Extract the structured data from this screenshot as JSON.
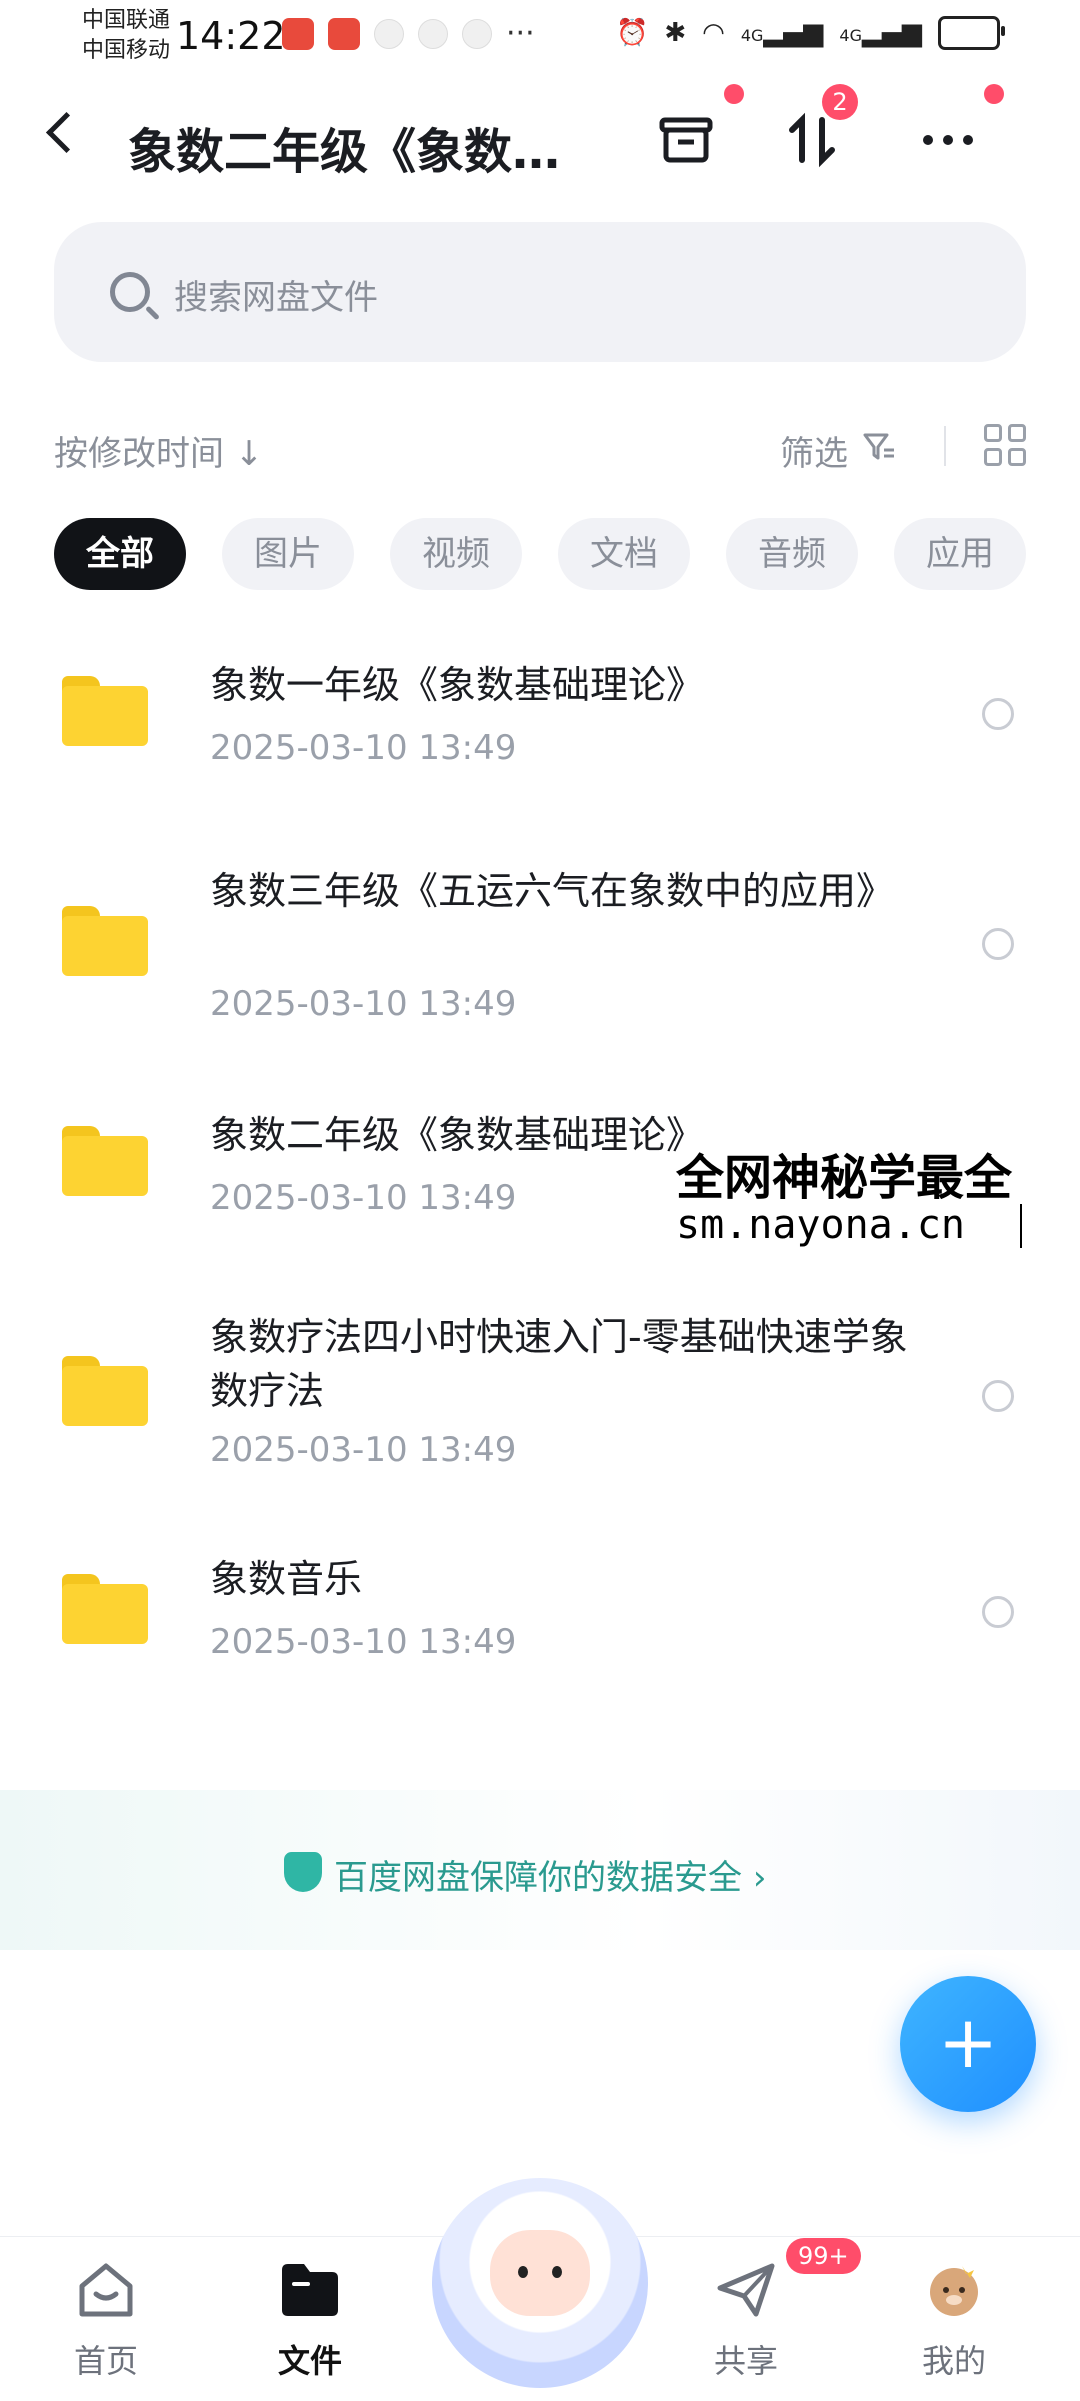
{
  "status_bar": {
    "carrier1": "中国联通",
    "carrier2": "中国移动",
    "time": "14:22",
    "dots": "···",
    "net1": "4G",
    "net2": "4G"
  },
  "header": {
    "title": "象数二年级《象数基础理论》",
    "transfer_badge": "2"
  },
  "search": {
    "placeholder": "搜索网盘文件"
  },
  "toolbar": {
    "sort_label": "按修改时间",
    "filter_label": "筛选"
  },
  "chips": [
    "全部",
    "图片",
    "视频",
    "文档",
    "音频",
    "应用"
  ],
  "files": [
    {
      "name": "象数一年级《象数基础理论》",
      "date": "2025-03-10  13:49"
    },
    {
      "name": "象数三年级《五运六气在象数中的应用》",
      "date": "2025-03-10  13:49"
    },
    {
      "name": "象数二年级《象数基础理论》",
      "date": "2025-03-10  13:49"
    },
    {
      "name": "象数疗法四小时快速入门-零基础快速学象数疗法",
      "date": "2025-03-10  13:49"
    },
    {
      "name": "象数音乐",
      "date": "2025-03-10  13:49"
    }
  ],
  "watermark": {
    "line1": "全网神秘学最全",
    "line2": "sm.nayona.cn"
  },
  "banner": {
    "text": "百度网盘保障你的数据安全"
  },
  "fab": {
    "label": "+"
  },
  "nav": {
    "home": "首页",
    "files": "文件",
    "share": "共享",
    "share_badge": "99+",
    "mine": "我的"
  },
  "colors": {
    "accent": "#1f8fff",
    "badge_red": "#ff4d6a",
    "folder_yellow": "#fdd332",
    "secure_green": "#2a9a8f"
  }
}
